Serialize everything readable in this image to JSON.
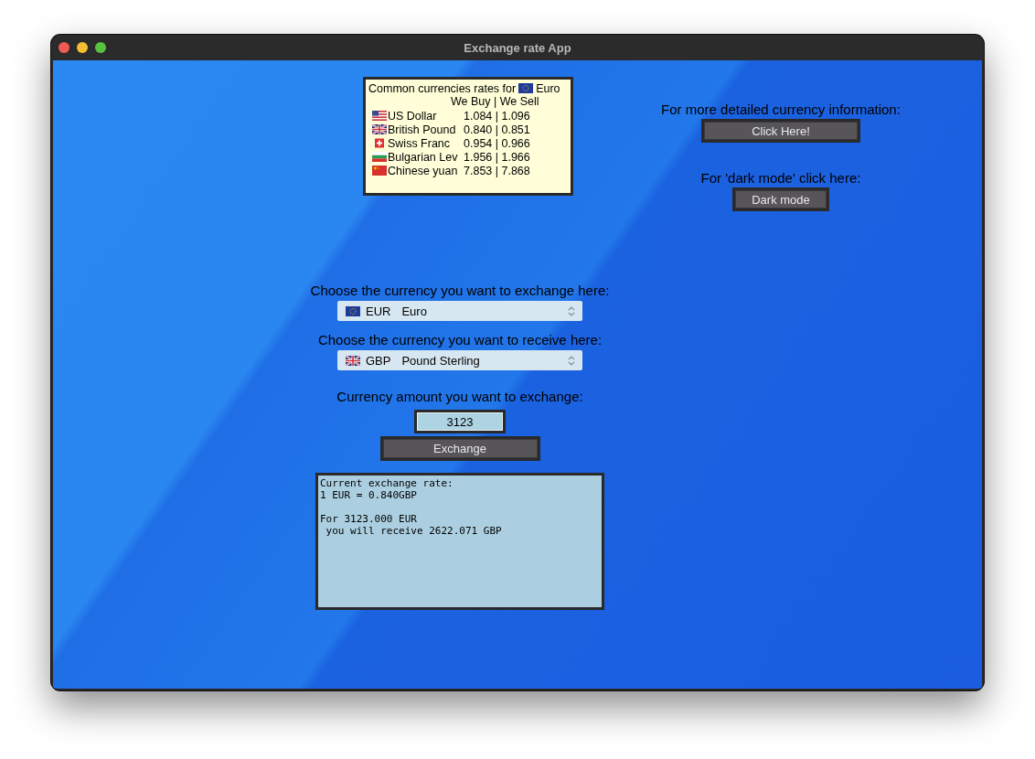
{
  "window": {
    "title": "Exchange rate App"
  },
  "rates": {
    "title": "Common currencies rates for",
    "title_flag": {
      "kind": "eu"
    },
    "title_currency": "Euro",
    "header": "We Buy | We Sell",
    "rows": [
      {
        "kind": "us",
        "name": "US Dollar",
        "values": "1.084 | 1.096"
      },
      {
        "kind": "gb",
        "name": "British Pound",
        "values": "0.840 | 0.851"
      },
      {
        "kind": "ch",
        "name": "Swiss Franc",
        "values": "0.954 | 0.966"
      },
      {
        "kind": "bg",
        "name": "Bulgarian Lev",
        "values": "1.956 | 1.966"
      },
      {
        "kind": "cn",
        "name": "Chinese yuan",
        "values": "7.853 | 7.868"
      }
    ]
  },
  "info": {
    "label": "For more detailed currency information:",
    "button": "Click Here!"
  },
  "dark_mode": {
    "label": "For 'dark mode' click here:",
    "button": "Dark mode"
  },
  "from": {
    "label": "Choose the currency you want to exchange here:",
    "kind": "eu",
    "code": "EUR",
    "name": "Euro"
  },
  "to": {
    "label": "Choose the currency you want to receive here:",
    "kind": "gb",
    "code": "GBP",
    "name": "Pound Sterling"
  },
  "amount": {
    "label": "Currency amount you want to exchange:",
    "value": "3123"
  },
  "exchange_button": "Exchange",
  "result": "Current exchange rate:\n1 EUR = 0.840GBP\n\nFor 3123.000 EUR\n you will receive 2622.071 GBP"
}
